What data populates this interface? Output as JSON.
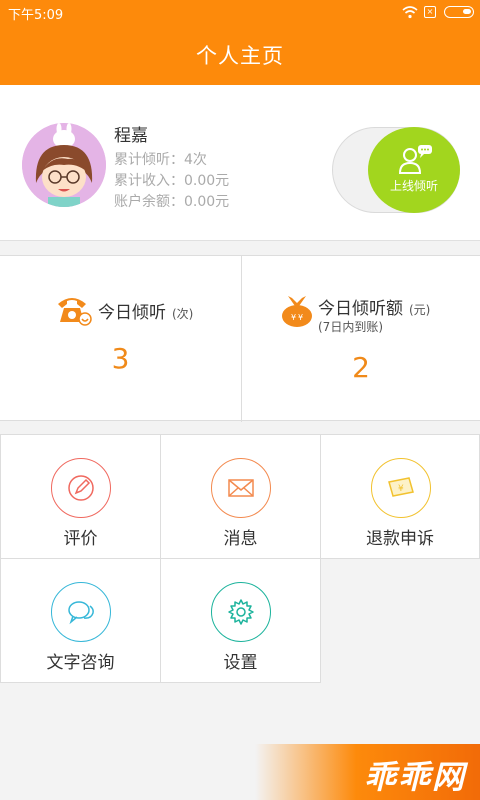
{
  "status_bar": {
    "time": "下午5:09",
    "sim_label": "×"
  },
  "header": {
    "title": "个人主页"
  },
  "profile": {
    "name": "程嘉",
    "stats": [
      "累计倾听：4次",
      "累计收入：0.00元",
      "账户余额：0.00元"
    ],
    "toggle_label": "上线倾听"
  },
  "today": {
    "listen": {
      "title": "今日倾听",
      "unit": "(次)",
      "value": "3"
    },
    "amount": {
      "title": "今日倾听额",
      "unit": "(元)",
      "sub": "(7日内到账)",
      "value": "2"
    }
  },
  "menu": {
    "items": [
      {
        "label": "评价",
        "icon": "pencil-icon",
        "color": "#f0695f"
      },
      {
        "label": "消息",
        "icon": "envelope-icon",
        "color": "#f38a4f"
      },
      {
        "label": "退款申诉",
        "icon": "money-note-icon",
        "color": "#f2c22f"
      },
      {
        "label": "文字咨询",
        "icon": "chat-bubbles-icon",
        "color": "#36b7d8"
      },
      {
        "label": "设置",
        "icon": "gear-icon",
        "color": "#1cb39c"
      }
    ]
  },
  "watermark": {
    "text": "乖乖网"
  },
  "colors": {
    "brand_orange": "#fd8a0b",
    "toggle_green": "#a2d61e",
    "value_orange": "#f08a1a"
  }
}
